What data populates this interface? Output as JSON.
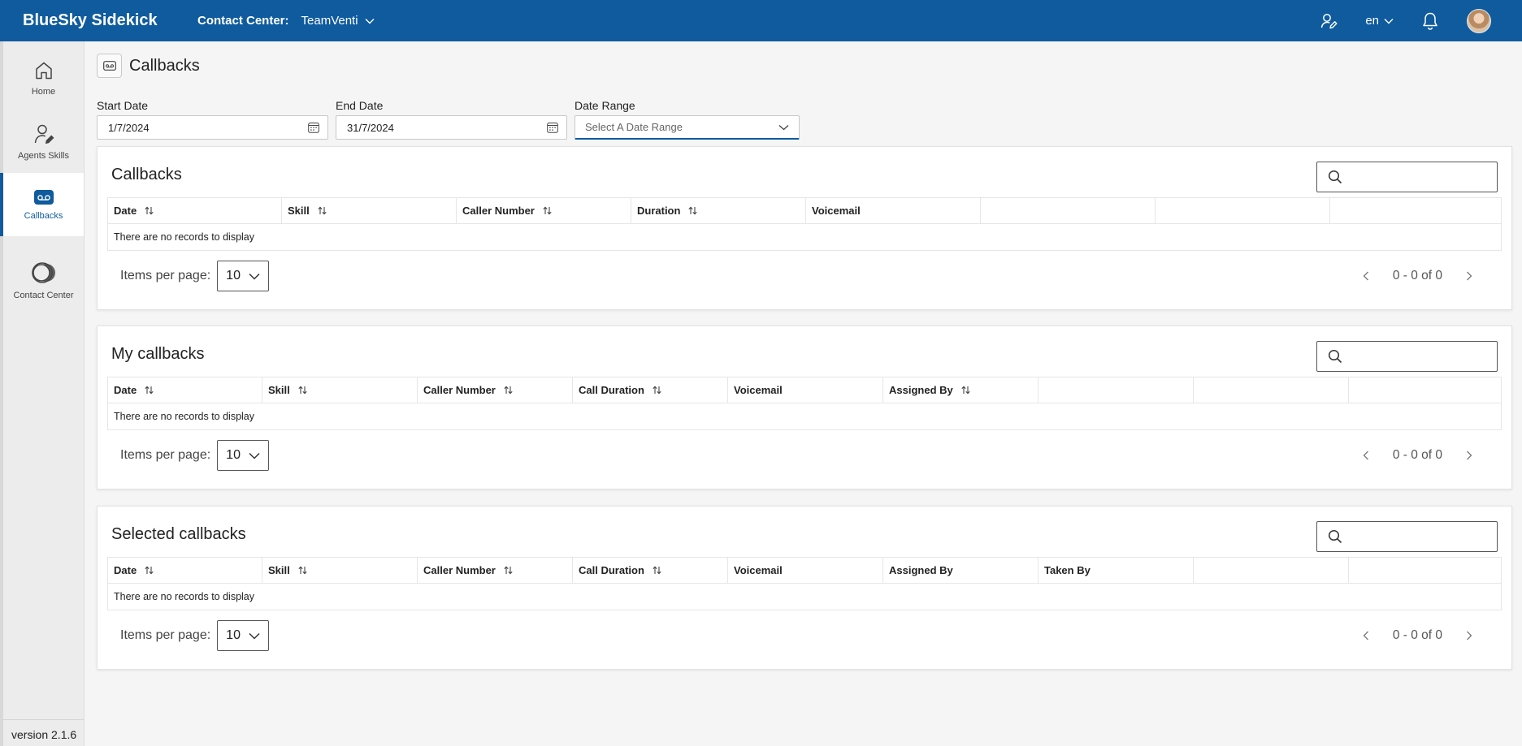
{
  "app": {
    "brand": "BlueSky Sidekick",
    "contact_center_label": "Contact Center:",
    "contact_center_value": "TeamVenti",
    "language": "en",
    "version": "version 2.1.6"
  },
  "sidebar": {
    "items": [
      {
        "label": "Home",
        "icon": "home-icon",
        "active": false
      },
      {
        "label": "Agents Skills",
        "icon": "agent-skills-icon",
        "active": false
      },
      {
        "label": "Callbacks",
        "icon": "voicemail-icon",
        "active": true
      },
      {
        "label": "Contact Center",
        "icon": "contact-center-icon",
        "active": false
      }
    ]
  },
  "page": {
    "title": "Callbacks"
  },
  "filters": {
    "start_date_label": "Start Date",
    "start_date_value": "1/7/2024",
    "end_date_label": "End Date",
    "end_date_value": "31/7/2024",
    "date_range_label": "Date Range",
    "date_range_placeholder": "Select A Date Range"
  },
  "sections": [
    {
      "title": "Callbacks",
      "columns": [
        {
          "label": "Date",
          "sortable": true
        },
        {
          "label": "Skill",
          "sortable": true
        },
        {
          "label": "Caller Number",
          "sortable": true
        },
        {
          "label": "Duration",
          "sortable": true
        },
        {
          "label": "Voicemail",
          "sortable": false
        },
        {
          "label": "",
          "sortable": false
        },
        {
          "label": "",
          "sortable": false
        },
        {
          "label": "",
          "sortable": false
        }
      ],
      "empty_text": "There are no records to display",
      "items_per_page_label": "Items per page:",
      "items_per_page": "10",
      "range_text": "0 - 0 of 0"
    },
    {
      "title": "My callbacks",
      "columns": [
        {
          "label": "Date",
          "sortable": true
        },
        {
          "label": "Skill",
          "sortable": true
        },
        {
          "label": "Caller Number",
          "sortable": true
        },
        {
          "label": "Call Duration",
          "sortable": true
        },
        {
          "label": "Voicemail",
          "sortable": false
        },
        {
          "label": "Assigned By",
          "sortable": true
        },
        {
          "label": "",
          "sortable": false
        },
        {
          "label": "",
          "sortable": false
        },
        {
          "label": "",
          "sortable": false
        }
      ],
      "empty_text": "There are no records to display",
      "items_per_page_label": "Items per page:",
      "items_per_page": "10",
      "range_text": "0 - 0 of 0"
    },
    {
      "title": "Selected callbacks",
      "columns": [
        {
          "label": "Date",
          "sortable": true
        },
        {
          "label": "Skill",
          "sortable": true
        },
        {
          "label": "Caller Number",
          "sortable": true
        },
        {
          "label": "Call Duration",
          "sortable": true
        },
        {
          "label": "Voicemail",
          "sortable": false
        },
        {
          "label": "Assigned By",
          "sortable": false
        },
        {
          "label": "Taken By",
          "sortable": false
        },
        {
          "label": "",
          "sortable": false
        },
        {
          "label": "",
          "sortable": false
        }
      ],
      "empty_text": "There are no records to display",
      "items_per_page_label": "Items per page:",
      "items_per_page": "10",
      "range_text": "0 - 0 of 0"
    }
  ],
  "colors": {
    "brand_blue": "#0f5b9e",
    "page_bg": "#f5f5f5",
    "sidebar_bg": "#ececec"
  }
}
